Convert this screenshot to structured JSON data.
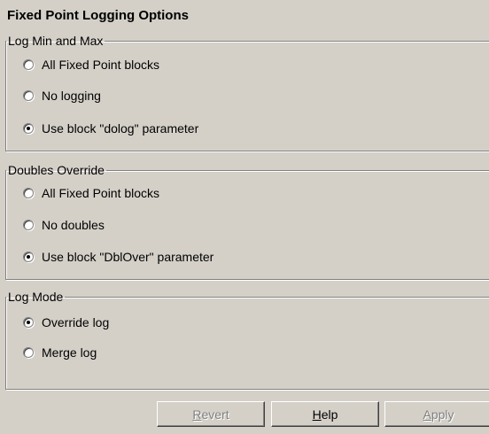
{
  "title": "Fixed Point Logging Options",
  "groups": [
    {
      "legend": "Log Min and Max",
      "options": [
        {
          "label": "All Fixed Point blocks",
          "checked": false
        },
        {
          "label": "No logging",
          "checked": false
        },
        {
          "label": "Use block \"dolog\" parameter",
          "checked": true
        }
      ]
    },
    {
      "legend": "Doubles Override",
      "options": [
        {
          "label": "All Fixed Point blocks",
          "checked": false
        },
        {
          "label": "No doubles",
          "checked": false
        },
        {
          "label": "Use block \"DblOver\" parameter",
          "checked": true
        }
      ]
    },
    {
      "legend": "Log Mode",
      "options": [
        {
          "label": "Override log",
          "checked": true
        },
        {
          "label": "Merge log",
          "checked": false
        }
      ]
    }
  ],
  "buttons": {
    "revert": {
      "label": "Revert",
      "enabled": false
    },
    "help": {
      "label": "Help",
      "enabled": true
    },
    "apply": {
      "label": "Apply",
      "enabled": false
    }
  },
  "colors": {
    "background": "#d4d0c8",
    "disabled_text": "#808080"
  }
}
